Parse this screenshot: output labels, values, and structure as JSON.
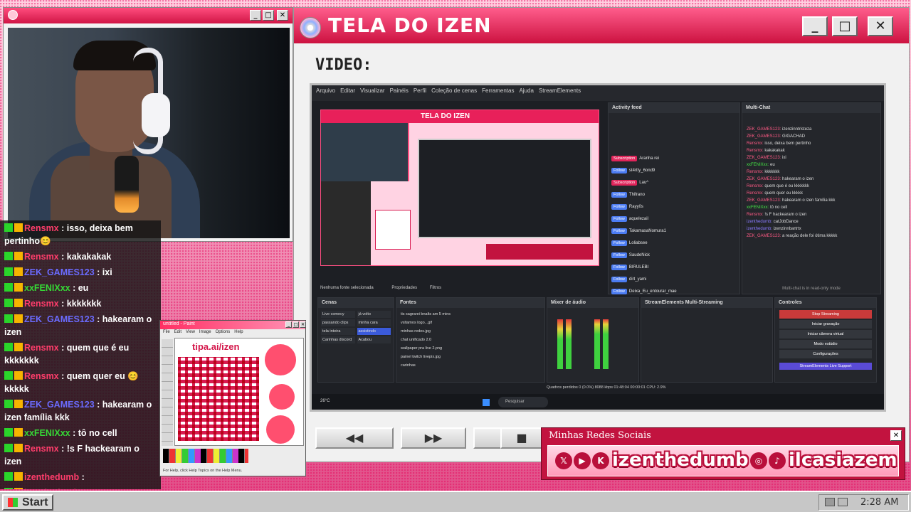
{
  "main_window": {
    "title": "TELA DO IZEN",
    "video_label": "VIDEO:"
  },
  "obs": {
    "menu": [
      "Arquivo",
      "Editar",
      "Visualizar",
      "Painéis",
      "Perfil",
      "Coleção de cenas",
      "Ferramentas",
      "Ajuda",
      "StreamElements"
    ],
    "preview_title": "TELA DO IZEN",
    "activity_feed_title": "Activity feed",
    "activity": [
      {
        "tag": "Subscription",
        "name": "Aranha rei"
      },
      {
        "tag": "Follow",
        "name": "st4rtty_6ond9"
      },
      {
        "tag": "Subscription",
        "name": "Lau^"
      },
      {
        "tag": "Follow",
        "name": "Thifrano"
      },
      {
        "tag": "Follow",
        "name": "Rayy0s"
      },
      {
        "tag": "Follow",
        "name": "aquelezail"
      },
      {
        "tag": "Follow",
        "name": "TakamasaNomura1"
      },
      {
        "tag": "Follow",
        "name": "Loliabsee"
      },
      {
        "tag": "Follow",
        "name": "SaudeNick"
      },
      {
        "tag": "Follow",
        "name": "BIRULEBI"
      },
      {
        "tag": "Follow",
        "name": "dirt_yami"
      },
      {
        "tag": "Follow",
        "name": "Deixa_Eu_entourar_mae"
      }
    ],
    "multichat_title": "Multi-Chat",
    "multichat": [
      {
        "user": "ZEK_GAMES123",
        "msg": "izenzinntristeza"
      },
      {
        "user": "ZEK_GAMES123",
        "msg": "GIGACHAD"
      },
      {
        "user": "Rensmx",
        "msg": "isso, deixa bem pertinho"
      },
      {
        "user": "Rensmx",
        "msg": "kakakakak"
      },
      {
        "user": "ZEK_GAMES123",
        "msg": "ixi"
      },
      {
        "user": "xxFENIXxx",
        "msg": "eu"
      },
      {
        "user": "Rensmx",
        "msg": "kkkkkkk"
      },
      {
        "user": "ZEK_GAMES123",
        "msg": "hakearam o izen"
      },
      {
        "user": "Rensmx",
        "msg": "quem que é eu kkkkkkk"
      },
      {
        "user": "Rensmx",
        "msg": "quem quer eu kkkkk"
      },
      {
        "user": "ZEK_GAMES123",
        "msg": "hakearam o izen família kkk"
      },
      {
        "user": "xxFENIXxx",
        "msg": "tô no cell"
      },
      {
        "user": "Rensmx",
        "msg": "!s F hackearam o izen"
      },
      {
        "user": "izenthedumb",
        "msg": "catJobDance"
      },
      {
        "user": "izenthedumb",
        "msg": "izenzinnbartrtx"
      },
      {
        "user": "ZEK_GAMES123",
        "msg": "a reação dele foi ótima kkkkk"
      }
    ],
    "multichat_footer": "Multi-chat is in read-only mode",
    "scenes_title": "Cenas",
    "scenes": [
      "Live comecy",
      "já volto",
      "passando clips",
      "minha cara",
      "tela inteira",
      "assistindo",
      "Carinhas discord",
      "Acabou"
    ],
    "sources_title": "Fontes",
    "sources": [
      "tis sagrarei bnalts am 5 mins",
      "vsltamos logo...gif",
      "minhas redes.jpg",
      "chat unificado 2.0",
      "wallpaper pra live 2.png",
      "painel twitch livepix.jpg",
      "carinhas"
    ],
    "mixer_title": "Mixer de áudio",
    "multistream_title": "StreamElements Multi-Streaming",
    "controls_title": "Controles",
    "controls": [
      "Stop Streaming",
      "Iniciar gravação",
      "Iniciar câmera virtual",
      "Modo estúdio",
      "Configurações"
    ],
    "se_live_support": "StreamElements Live Support",
    "status": "Quadros perdidos 0 (0.0%)   8088 kbps   01:48:04   00:00:01   CPU: 2.9%",
    "search": "Pesquisar",
    "weather": "26°C",
    "no_source": "Nenhuma fonte selecionada",
    "properties": "Propriedades",
    "filters": "Filtros"
  },
  "chat": [
    {
      "user": "Rensmx",
      "msg": "isso, deixa bem pertinho😊",
      "color": "red"
    },
    {
      "user": "Rensmx",
      "msg": "kakakakak",
      "color": "red"
    },
    {
      "user": "ZEK_GAMES123",
      "msg": "ixi",
      "color": "alt"
    },
    {
      "user": "xxFENIXxx",
      "msg": "eu",
      "color": "green"
    },
    {
      "user": "Rensmx",
      "msg": "kkkkkkk",
      "color": "red"
    },
    {
      "user": "ZEK_GAMES123",
      "msg": "hakearam o izen",
      "color": "alt"
    },
    {
      "user": "Rensmx",
      "msg": "quem que é eu kkkkkkk",
      "color": "red"
    },
    {
      "user": "Rensmx",
      "msg": "quem quer eu 😊 kkkkk",
      "color": "red"
    },
    {
      "user": "ZEK_GAMES123",
      "msg": "hakearam o izen família kkk",
      "color": "alt"
    },
    {
      "user": "xxFENIXxx",
      "msg": "tô no cell",
      "color": "green"
    },
    {
      "user": "Rensmx",
      "msg": "!s F hackearam o izen",
      "color": "red"
    },
    {
      "user": "izenthedumb",
      "msg": "",
      "color": "red"
    },
    {
      "user": "izenthedumb",
      "msg": "",
      "color": "red"
    },
    {
      "user": "ZEK_GAMES123",
      "msg": "a reação dele foi ótima kkkkk",
      "color": "alt"
    }
  ],
  "paint": {
    "title": "untitled - Paint",
    "menu": [
      "File",
      "Edit",
      "View",
      "Image",
      "Options",
      "Help"
    ],
    "url": "tipa.ai/izen",
    "status": "For Help, click Help Topics on the Help Menu."
  },
  "social": {
    "title": "Minhas Redes Sociais",
    "handle_1": "izenthedumb",
    "handle_2": "ilcasiazem"
  },
  "taskbar": {
    "start": "Start",
    "time": "2:28 AM"
  },
  "colors": {
    "accent": "#e0245a",
    "accent_dark": "#b90f3b",
    "taskbar": "#c7c7c7"
  }
}
